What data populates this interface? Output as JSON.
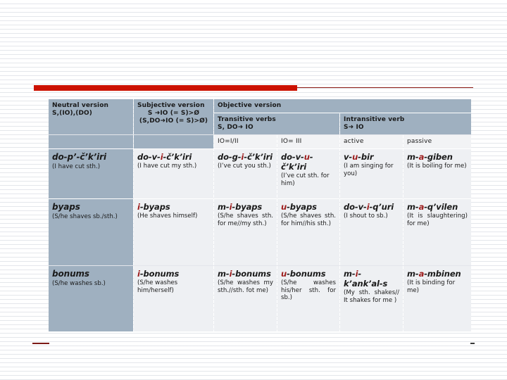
{
  "accent": {
    "bar_color": "#cc1100",
    "line_color": "#8c1a14"
  },
  "palette": {
    "header_bg": "#9fb0c0",
    "cell_bg": "#eef0f3",
    "marker_red": "#9c1b1b"
  },
  "table": {
    "group_headers": {
      "neutral": {
        "title": "Neutral version",
        "formula": "S,(IO),(DO)"
      },
      "subjective": {
        "title": "Subjective version",
        "formula_1": "S ➜IO (= S)>Ø",
        "formula_2": "(S,DO➜IO (= S)>Ø)"
      },
      "objective": {
        "title": "Objective version",
        "transitive": {
          "title": "Transitive verbs",
          "formula": "S, DO➜ IO"
        },
        "intransitive": {
          "title": "Intransitive verb",
          "formula": "S➜ IO"
        }
      }
    },
    "sub_headers": {
      "io_1_2": "IO=I/II",
      "io_3": "IO= III",
      "active": "active",
      "passive": "passive"
    },
    "rows": [
      {
        "neutral": {
          "form_parts": [
            {
              "t": "do-p’-č’k’iri",
              "mark": false
            }
          ],
          "gloss": "(I have cut sth.)"
        },
        "subjective": {
          "form_parts": [
            {
              "t": "do-v-",
              "mark": false
            },
            {
              "t": "i",
              "mark": true
            },
            {
              "t": "-č’k’iri",
              "mark": false
            }
          ],
          "gloss": "(I have cut my sth.)"
        },
        "io_1_2": {
          "form_parts": [
            {
              "t": "do-g-",
              "mark": false
            },
            {
              "t": "i",
              "mark": true
            },
            {
              "t": "-č’k’iri",
              "mark": false
            }
          ],
          "gloss": "(I’ve cut you sth.)"
        },
        "io_3": {
          "form_parts": [
            {
              "t": "do-v-",
              "mark": false
            },
            {
              "t": "u",
              "mark": true
            },
            {
              "t": "-č’k’iri",
              "mark": false
            }
          ],
          "gloss": "(I’ve cut sth. for him)"
        },
        "active": {
          "form_parts": [
            {
              "t": "v-",
              "mark": false
            },
            {
              "t": "u",
              "mark": true
            },
            {
              "t": "-bir",
              "mark": false
            }
          ],
          "gloss": "(I am singing for you)"
        },
        "passive": {
          "form_parts": [
            {
              "t": "m-",
              "mark": false
            },
            {
              "t": "a",
              "mark": true
            },
            {
              "t": "-giben",
              "mark": false
            }
          ],
          "gloss": "(It is boiling for me)"
        }
      },
      {
        "neutral": {
          "form_parts": [
            {
              "t": "byaps",
              "mark": false
            }
          ],
          "gloss": "(S/he shaves sb./sth.)"
        },
        "subjective": {
          "form_parts": [
            {
              "t": "i",
              "mark": true
            },
            {
              "t": "-byaps",
              "mark": false
            }
          ],
          "gloss": "(He shaves himself)"
        },
        "io_1_2": {
          "form_parts": [
            {
              "t": "m-",
              "mark": false
            },
            {
              "t": "i",
              "mark": true
            },
            {
              "t": "-byaps",
              "mark": false
            }
          ],
          "gloss": "(S/he shaves sth. for me//my sth.)"
        },
        "io_3": {
          "form_parts": [
            {
              "t": "u",
              "mark": true
            },
            {
              "t": "-byaps",
              "mark": false
            }
          ],
          "gloss": "(S/he shaves sth. for him//his sth.)"
        },
        "active": {
          "form_parts": [
            {
              "t": "do-v-",
              "mark": false
            },
            {
              "t": "i",
              "mark": true
            },
            {
              "t": "-q’uri",
              "mark": false
            }
          ],
          "gloss": "(I shout to sb.)"
        },
        "passive": {
          "form_parts": [
            {
              "t": "m-",
              "mark": false
            },
            {
              "t": "a",
              "mark": true
            },
            {
              "t": "-q’vilen",
              "mark": false
            }
          ],
          "gloss": "(It is slaughtering) for me)"
        }
      },
      {
        "neutral": {
          "form_parts": [
            {
              "t": "bonums",
              "mark": false
            }
          ],
          "gloss": "(S/he washes sb.)"
        },
        "subjective": {
          "form_parts": [
            {
              "t": "i",
              "mark": true
            },
            {
              "t": "-bonums",
              "mark": false
            }
          ],
          "gloss": "(S/he washes him/herself)"
        },
        "io_1_2": {
          "form_parts": [
            {
              "t": "m-",
              "mark": false
            },
            {
              "t": "i",
              "mark": true
            },
            {
              "t": "-bonums",
              "mark": false
            }
          ],
          "gloss": "(S/he washes my sth.//sth. fot me)"
        },
        "io_3": {
          "form_parts": [
            {
              "t": "u",
              "mark": true
            },
            {
              "t": "-bonums",
              "mark": false
            }
          ],
          "gloss": "(S/he washes his/her sth. for sb.)"
        },
        "active": {
          "form_parts": [
            {
              "t": "m-",
              "mark": false
            },
            {
              "t": "i",
              "mark": true
            },
            {
              "t": "-k’ank’al-s",
              "mark": false
            }
          ],
          "gloss": "(My sth. shakes// It shakes for me )"
        },
        "passive": {
          "form_parts": [
            {
              "t": "m-",
              "mark": false
            },
            {
              "t": "a",
              "mark": true
            },
            {
              "t": "-mbinen",
              "mark": false
            }
          ],
          "gloss": "(It is binding for me)"
        }
      }
    ]
  }
}
